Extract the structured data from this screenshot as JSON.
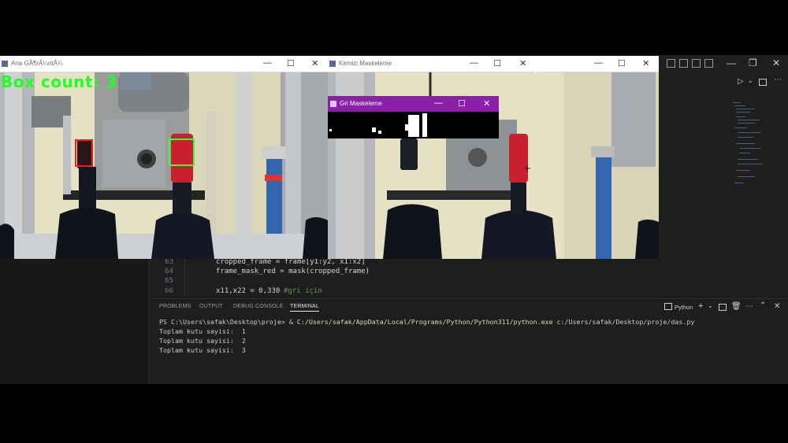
{
  "windows": {
    "main": {
      "title": "Ana GÃ¶rÃ¼ntÃ¼",
      "overlay_text": "Box count: 3"
    },
    "red_mask": {
      "title": "Kirmizi Maskeleme"
    },
    "gray_mask": {
      "title": "Gri Maskeleme"
    }
  },
  "editor": {
    "lines": [
      {
        "number": "63",
        "code": "cropped_frame = frame[y1:y2, x1:x2]"
      },
      {
        "number": "64",
        "code": "frame_mask_red = mask(cropped_frame)"
      },
      {
        "number": "65",
        "code": ""
      },
      {
        "number": "66",
        "code": "x11,x22 = 0,330",
        "comment": "#gri için"
      }
    ]
  },
  "panel": {
    "tabs": [
      "PROBLEMS",
      "OUTPUT",
      "DEBUG CONSOLE",
      "TERMINAL"
    ],
    "active_tab": "TERMINAL",
    "shell_label": "Python",
    "terminal": {
      "prompt": "PS C:\\Users\\safak\\Desktop\\proje> & ",
      "command": "C:/Users/safak/AppData/Local/Programs/Python/Python311/python.exe",
      "argument": " c:/Users/safak/Desktop/proje/das.py",
      "output": [
        "Toplam kutu sayisi:  1",
        "Toplam kutu sayisi:  2",
        "Toplam kutu sayisi:  3"
      ]
    }
  },
  "colors": {
    "overlay_green": "#22ff22",
    "detect_box_green": "#3cff3c",
    "detect_box_red": "#ff1a1a",
    "gray_title_bar": "#8a1fa8",
    "bottle_cap_red": "#c8202c",
    "command_yellow": "#dcdcaa"
  }
}
